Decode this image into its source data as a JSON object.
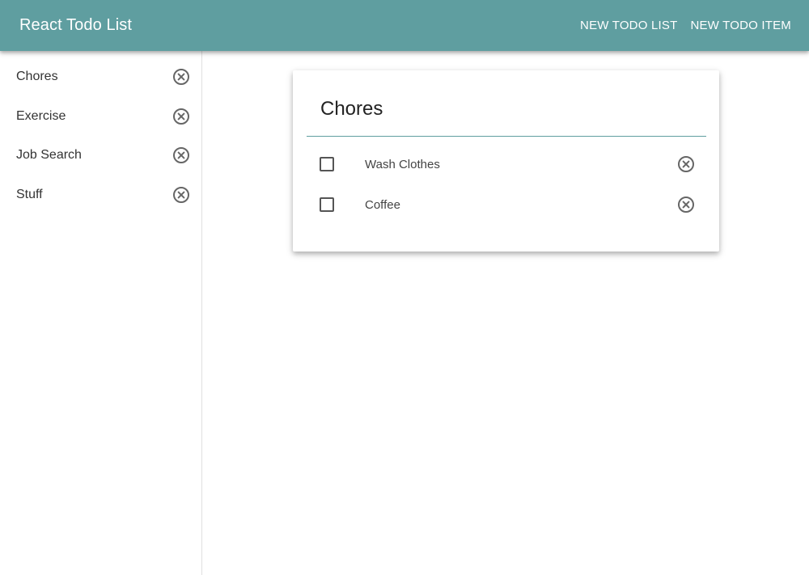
{
  "app_bar": {
    "title": "React Todo List",
    "actions": [
      {
        "label": "NEW TODO LIST"
      },
      {
        "label": "NEW TODO ITEM"
      }
    ],
    "background_color": "#5f9ea0"
  },
  "sidebar": {
    "items": [
      {
        "label": "Chores",
        "icon": "close-circle-icon"
      },
      {
        "label": "Exercise",
        "icon": "close-circle-icon"
      },
      {
        "label": "Job Search",
        "icon": "close-circle-icon"
      },
      {
        "label": "Stuff",
        "icon": "close-circle-icon"
      }
    ]
  },
  "todo_card": {
    "title": "Chores",
    "divider_color": "#5f9ea0",
    "items": [
      {
        "label": "Wash Clothes",
        "checked": false,
        "icon": "close-circle-icon"
      },
      {
        "label": "Coffee",
        "checked": false,
        "icon": "close-circle-icon"
      }
    ]
  }
}
